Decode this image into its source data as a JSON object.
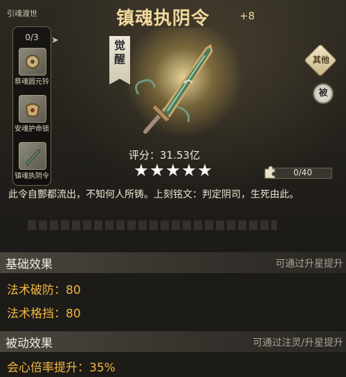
{
  "set": {
    "title": "引魂渡世",
    "count": "0/3",
    "items": [
      {
        "label": "祭魂圆元铃",
        "icon": "bell-icon"
      },
      {
        "label": "安魂护命锁",
        "icon": "lock-charm-icon"
      },
      {
        "label": "镇魂执阴令",
        "icon": "sword-token-icon"
      }
    ]
  },
  "item": {
    "name": "镇魂执阴令",
    "level": "+8",
    "awaken_label": "觉醒",
    "rating": "评分：31.53亿",
    "stars": 5,
    "progress_text": "0/40",
    "progress_value": 0,
    "description": "此令自酆都流出，不知何人所铸。上刻铭文：判定阴司，生死由此。"
  },
  "side_buttons": {
    "other": "其他",
    "passive": "被"
  },
  "basic": {
    "title": "基础效果",
    "hint": "可通过升星提升",
    "stats": [
      "法术破防：80",
      "法术格挡：80"
    ]
  },
  "passive": {
    "title": "被动效果",
    "hint": "可通过注灵/升星提升",
    "stats": [
      "会心倍率提升：35%"
    ]
  },
  "colors": {
    "title_gold": "#f1d99c",
    "stat_orange": "#f0b840",
    "bg": "#1d1b18"
  }
}
